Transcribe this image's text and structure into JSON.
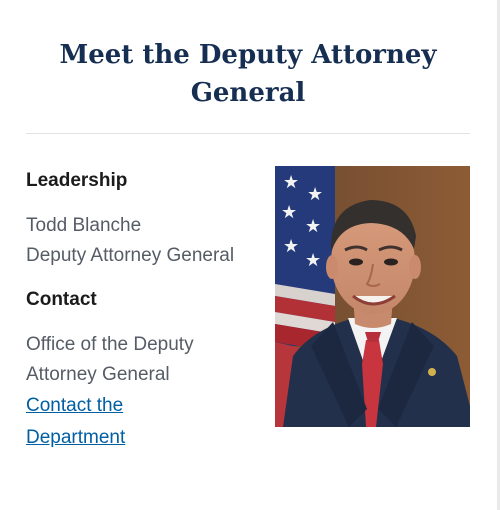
{
  "page": {
    "title": "Meet the Deputy Attorney General"
  },
  "leadership": {
    "heading": "Leadership",
    "name": "Todd Blanche",
    "role": "Deputy Attorney General"
  },
  "contact": {
    "heading": "Contact",
    "office_line1": "Office of the Deputy",
    "office_line2": "Attorney General",
    "link_line1": "Contact the",
    "link_line2": "Department"
  },
  "colors": {
    "title": "#162e51",
    "body_text": "#565c65",
    "link": "#005ea2",
    "divider": "#e2e2e2"
  },
  "portrait": {
    "subject": "official-portrait-photo",
    "background": "american-flag-and-brown-backdrop"
  }
}
